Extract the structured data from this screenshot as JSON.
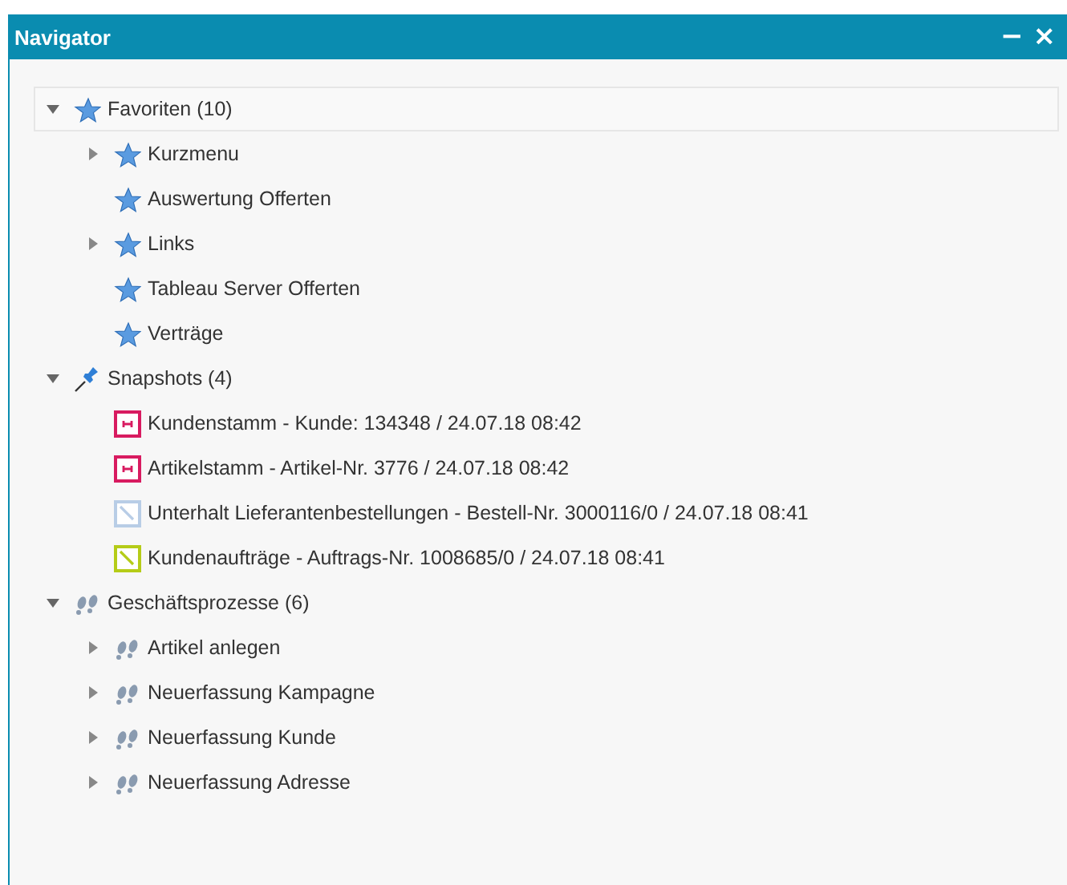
{
  "window": {
    "title": "Navigator",
    "controls": [
      "−",
      "×"
    ]
  },
  "tree": [
    {
      "label": "Favoriten (10)",
      "kind": "star",
      "expanded": true,
      "selected": true,
      "children": [
        {
          "label": "Kurzmenu",
          "kind": "star",
          "expanded": false,
          "selected": false
        },
        {
          "label": "Auswertung Offerten",
          "kind": "star",
          "selected": false
        },
        {
          "label": "Links",
          "kind": "star",
          "expanded": false,
          "selected": false
        },
        {
          "label": "Tableau Server Offerten",
          "kind": "star",
          "selected": false
        },
        {
          "label": "Verträge",
          "kind": "star",
          "selected": false
        }
      ]
    },
    {
      "label": "Snapshots (4)",
      "kind": "pin",
      "expanded": true,
      "selected": false,
      "children": [
        {
          "label": "Kundenstamm - Kunde: 134348 / 24.07.18 08:42",
          "kind": "record",
          "color": "#d81b60",
          "selected": false
        },
        {
          "label": "Artikelstamm - Artikel-Nr. 3776 / 24.07.18 08:42",
          "kind": "record",
          "color": "#d81b60",
          "selected": false
        },
        {
          "label": "Unterhalt Lieferantenbestellungen - Bestell-Nr. 3000116/0 / 24.07.18 08:41",
          "kind": "slash",
          "color": "#b8cde6",
          "selected": false
        },
        {
          "label": "Kundenaufträge - Auftrags-Nr. 1008685/0 / 24.07.18 08:41",
          "kind": "slash",
          "color": "#b5cc18",
          "selected": false
        }
      ]
    },
    {
      "label": "Geschäftsprozesse (6)",
      "kind": "steps",
      "expanded": true,
      "selected": false,
      "children": [
        {
          "label": "Artikel anlegen",
          "kind": "steps",
          "expanded": false,
          "selected": false
        },
        {
          "label": "Neuerfassung Kampagne",
          "kind": "steps",
          "expanded": false,
          "selected": false
        },
        {
          "label": "Neuerfassung Kunde",
          "kind": "steps",
          "expanded": false,
          "selected": false
        },
        {
          "label": "Neuerfassung Adresse",
          "kind": "steps",
          "expanded": false,
          "selected": false
        }
      ]
    }
  ]
}
